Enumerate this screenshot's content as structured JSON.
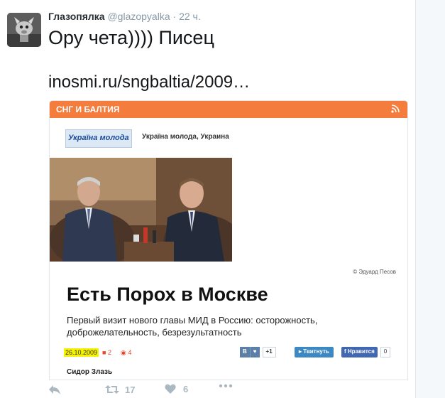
{
  "tweet": {
    "author_name": "Глазопялка",
    "handle": "@glazopyalka",
    "separator": "·",
    "time": "22 ч.",
    "text_line1": "Ору чета)))) Писец",
    "link": "inosmi.ru/sngbaltia/2009…"
  },
  "card": {
    "section": "СНГ И БАЛТИЯ",
    "logo_text": "Україна молода",
    "source": "Україна молода, Украина",
    "photo_credit": "© Эдуард Песов",
    "headline": "Есть Порох в Москве",
    "subtitle": "Первый визит нового главы МИД в Россию: осторожность, доброжелательность, безрезультатность",
    "date": "26.10.2009",
    "comments": "2",
    "views": "4",
    "vk_label": "В",
    "vk_count": "+1",
    "twitter_label": "Твитнуть",
    "fb_label": "Нравится",
    "fb_count": "0",
    "author": "Сидор Злазь"
  },
  "actions": {
    "retweets": "17",
    "likes": "6"
  },
  "colors": {
    "accent_orange": "#f47c3c",
    "date_highlight": "#f7f200",
    "action_gray": "#aab8c2"
  }
}
